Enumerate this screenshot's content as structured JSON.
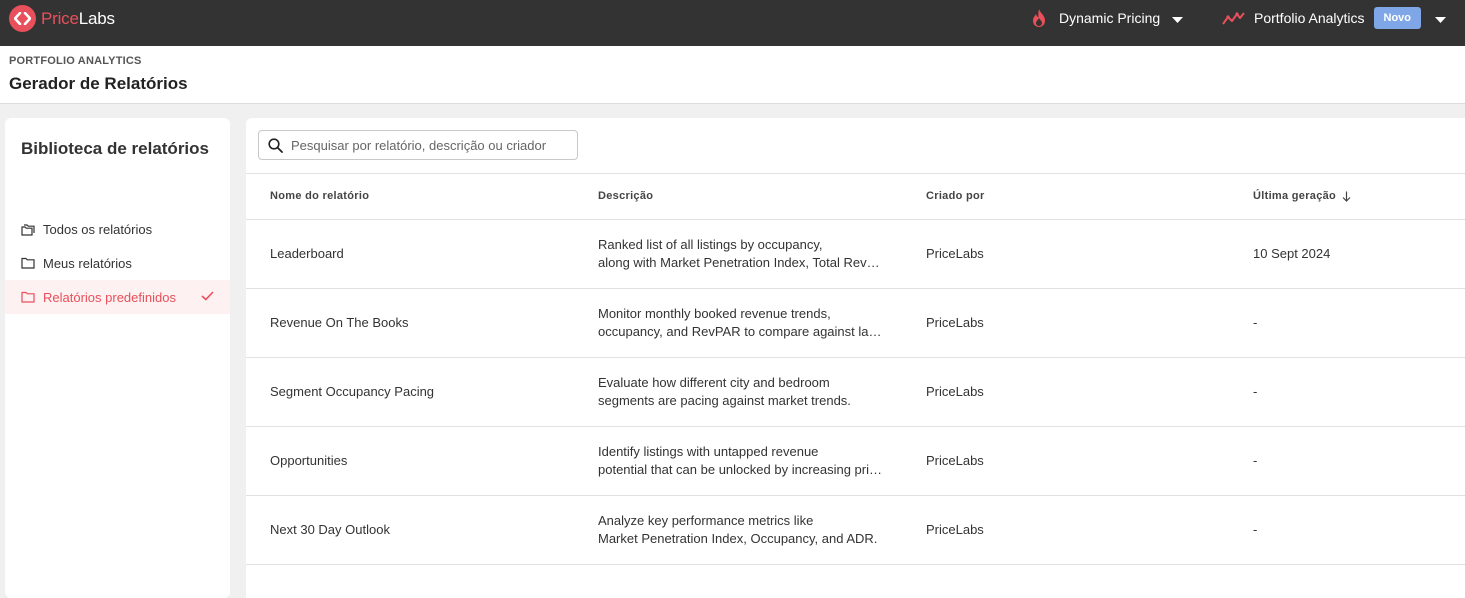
{
  "topbar": {
    "logo": {
      "price": "Price",
      "labs": "Labs"
    },
    "dynamic_pricing": "Dynamic Pricing",
    "portfolio_analytics": "Portfolio Analytics",
    "badge_new": "Novo",
    "colors": {
      "bar": "#333333",
      "accent": "#e8505b",
      "badge": "#7fa7e8"
    }
  },
  "header": {
    "eyebrow": "PORTFOLIO ANALYTICS",
    "title": "Gerador de Relatórios"
  },
  "sidebar": {
    "title": "Biblioteca de relatórios",
    "items": [
      {
        "label": "Todos os relatórios",
        "icon": "folders-icon"
      },
      {
        "label": "Meus relatórios",
        "icon": "folder-icon"
      },
      {
        "label": "Relatórios predefinidos",
        "icon": "folder-icon",
        "active": true
      }
    ]
  },
  "search": {
    "placeholder": "Pesquisar por relatório, descrição ou criador"
  },
  "table": {
    "columns": [
      "Nome do relatório",
      "Descrição",
      "Criado por",
      "Última geração"
    ],
    "rows": [
      {
        "name": "Leaderboard",
        "desc1": "Ranked list of all listings by occupancy,",
        "desc2": "along with Market Penetration Index, Total Revenue and more.",
        "creator": "PriceLabs",
        "last": "10 Sept 2024"
      },
      {
        "name": "Revenue On The Books",
        "desc1": "Monitor monthly booked revenue trends,",
        "desc2": "occupancy, and RevPAR to compare against last year.",
        "creator": "PriceLabs",
        "last": "-"
      },
      {
        "name": "Segment Occupancy Pacing",
        "desc1": "Evaluate how different city and bedroom",
        "desc2": "segments are pacing against market trends.",
        "creator": "PriceLabs",
        "last": "-"
      },
      {
        "name": "Opportunities",
        "desc1": "Identify listings with untapped revenue",
        "desc2": "potential that can be unlocked by increasing prices.",
        "creator": "PriceLabs",
        "last": "-"
      },
      {
        "name": "Next 30 Day Outlook",
        "desc1": "Analyze key performance metrics like",
        "desc2": "Market Penetration Index, Occupancy, and ADR.",
        "creator": "PriceLabs",
        "last": "-"
      }
    ]
  }
}
